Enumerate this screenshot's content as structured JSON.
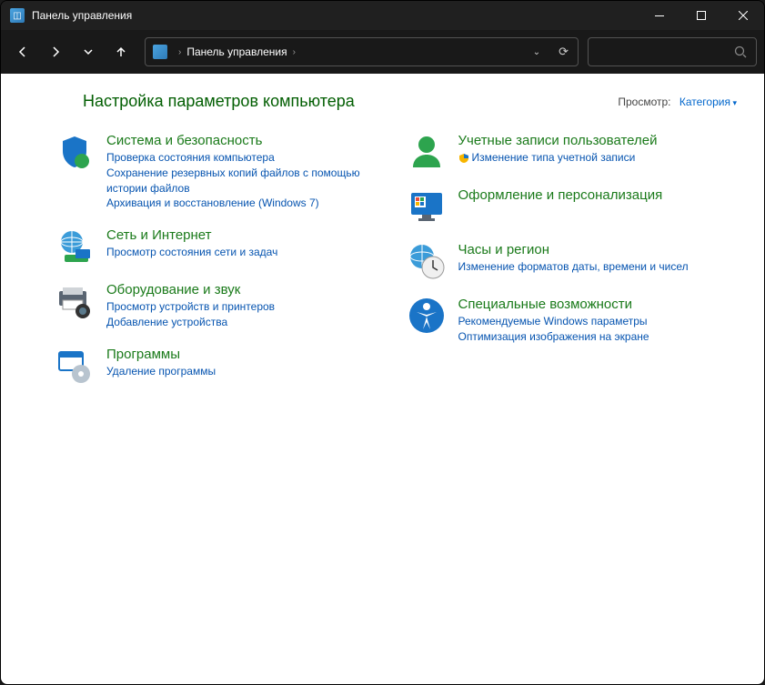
{
  "window": {
    "title": "Панель управления"
  },
  "breadcrumb": {
    "segment": "Панель управления"
  },
  "header": {
    "title": "Настройка параметров компьютера",
    "view_label": "Просмотр:",
    "view_value": "Категория"
  },
  "categories": {
    "system": {
      "title": "Система и безопасность",
      "links": [
        "Проверка состояния компьютера",
        "Сохранение резервных копий файлов с помощью истории файлов",
        "Архивация и восстановление (Windows 7)"
      ]
    },
    "network": {
      "title": "Сеть и Интернет",
      "links": [
        "Просмотр состояния сети и задач"
      ]
    },
    "hardware": {
      "title": "Оборудование и звук",
      "links": [
        "Просмотр устройств и принтеров",
        "Добавление устройства"
      ]
    },
    "programs": {
      "title": "Программы",
      "links": [
        "Удаление программы"
      ]
    },
    "users": {
      "title": "Учетные записи пользователей",
      "links": [
        "Изменение типа учетной записи"
      ]
    },
    "personalization": {
      "title": "Оформление и персонализация",
      "links": []
    },
    "clock": {
      "title": "Часы и регион",
      "links": [
        "Изменение форматов даты, времени и чисел"
      ]
    },
    "access": {
      "title": "Специальные возможности",
      "links": [
        "Рекомендуемые Windows параметры",
        "Оптимизация изображения на экране"
      ]
    }
  }
}
